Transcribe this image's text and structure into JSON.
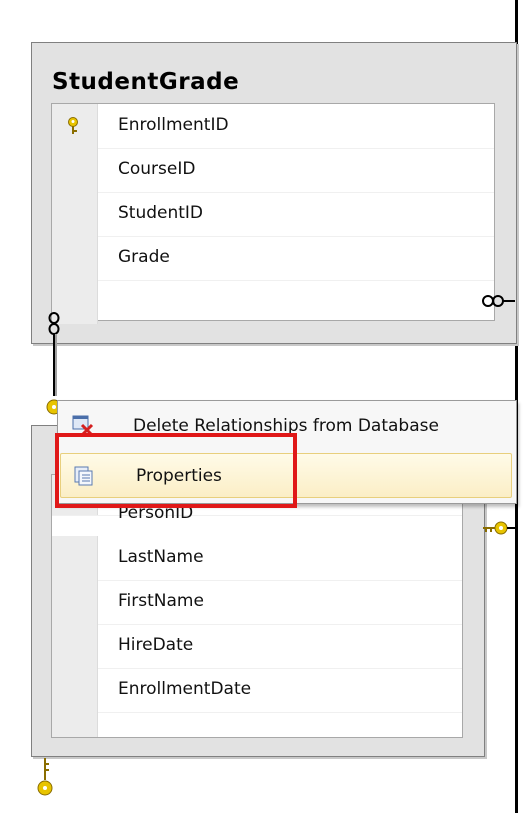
{
  "table_studentgrade": {
    "title": "StudentGrade",
    "columns": [
      "EnrollmentID",
      "CourseID",
      "StudentID",
      "Grade"
    ]
  },
  "table_person": {
    "columns_visible": [
      "PersonID",
      "LastName",
      "FirstName",
      "HireDate",
      "EnrollmentDate"
    ]
  },
  "context_menu": {
    "items": [
      {
        "label": "Delete Relationships from Database",
        "icon": "delete-relationship-icon"
      },
      {
        "label": "Properties",
        "icon": "properties-icon",
        "highlighted": true
      }
    ]
  },
  "colors": {
    "highlight_box": "#e01818",
    "key_icon": "#e8c400",
    "menu_hover": "#fbeec6"
  }
}
